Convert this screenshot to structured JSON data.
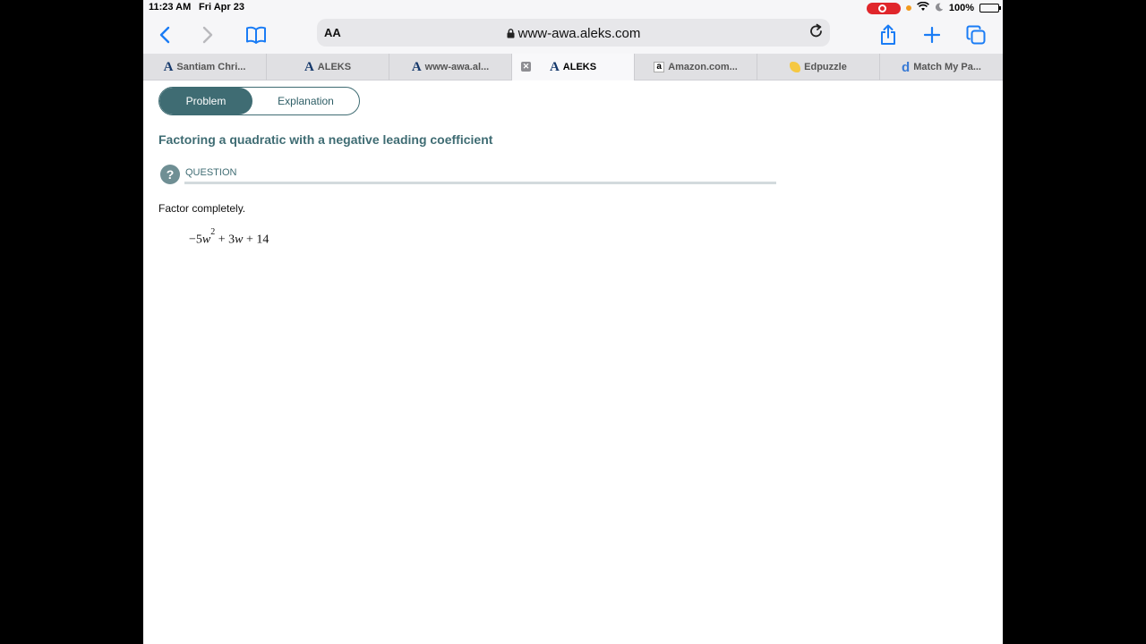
{
  "status_bar": {
    "time": "11:23 AM",
    "date": "Fri Apr 23",
    "battery": "100%",
    "battery_level": 1.0
  },
  "toolbar": {
    "text_size_label": "AA",
    "url": "www-awa.aleks.com"
  },
  "tabs": [
    {
      "label": "Santiam Chri...",
      "favicon": "aleks-icon"
    },
    {
      "label": "ALEKS",
      "favicon": "aleks-icon"
    },
    {
      "label": "www-awa.al...",
      "favicon": "aleks-icon"
    },
    {
      "label": "ALEKS",
      "favicon": "aleks-icon",
      "active": true
    },
    {
      "label": "Amazon.com...",
      "favicon": "amazon-icon"
    },
    {
      "label": "Edpuzzle",
      "favicon": "edpuzzle-icon"
    },
    {
      "label": "Match My Pa...",
      "favicon": "d-icon"
    }
  ],
  "segmented": {
    "problem": "Problem",
    "explanation": "Explanation",
    "selected": "Problem"
  },
  "problem": {
    "title": "Factoring a quadratic with a negative leading coefficient",
    "question_icon": "?",
    "question_label": "QUESTION",
    "instruction": "Factor completely.",
    "expression": {
      "sign": "−",
      "coef1": "5",
      "var1": "w",
      "exp": "2",
      "op1": "+",
      "coef2": "3",
      "var2": "w",
      "op2": "+",
      "const": "14"
    }
  },
  "colors": {
    "accent": "#3f6c73",
    "ios_blue": "#1a7cf5",
    "record_red": "#e0262b"
  }
}
